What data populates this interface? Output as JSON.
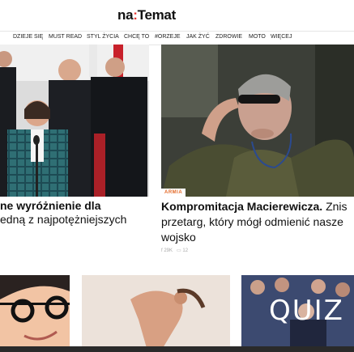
{
  "header": {
    "logo_main": "na",
    "logo_colon": ":",
    "logo_rest": "Temat"
  },
  "nav": {
    "items": [
      "DZIEJE SIĘ",
      "MUST READ",
      "STYL ŻYCIA",
      "CHCĘ TO",
      "#ORZEJE",
      "JAK ŻYĆ",
      "ZDROWIE",
      "MOTO",
      "WIĘCEJ"
    ]
  },
  "articles": {
    "left": {
      "title_bold": "ne wyróżnienie dla",
      "title_rest": "edną z najpotężniejszych"
    },
    "main": {
      "tag": "ARMIA",
      "title_bold": "Kompromitacja Macierewicza.",
      "title_rest": " Znis przetarg, który mógł odmienić nasze wojsko",
      "share_count": "29K",
      "comment_count": "12"
    },
    "bottom_right_text": "QUIZ"
  },
  "colors": {
    "accent_red": "#e3342f",
    "tag_orange": "#e36b2a"
  }
}
